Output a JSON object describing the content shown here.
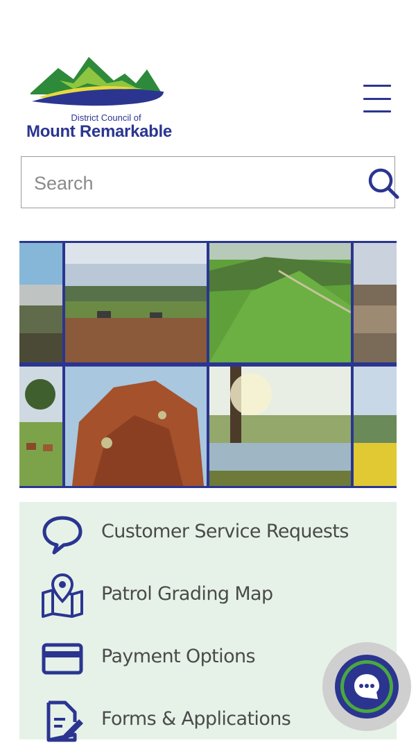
{
  "header": {
    "logo_subtitle": "District Council of",
    "logo_title": "Mount Remarkable",
    "menu_icon": "hamburger-menu-icon"
  },
  "search": {
    "placeholder": "Search",
    "icon": "search-icon"
  },
  "quick_links": [
    {
      "label": "Customer Service Requests",
      "icon": "speech-bubble-icon"
    },
    {
      "label": "Patrol Grading Map",
      "icon": "map-pin-icon"
    },
    {
      "label": "Payment Options",
      "icon": "credit-card-icon"
    },
    {
      "label": "Forms & Applications",
      "icon": "document-edit-icon"
    }
  ],
  "chat": {
    "icon": "chat-bubble-icon"
  },
  "colors": {
    "brand_navy": "#2b3590",
    "brand_green": "#4aa83f",
    "brand_yellow": "#e7d93b",
    "quick_links_bg": "#e6f2e8"
  }
}
